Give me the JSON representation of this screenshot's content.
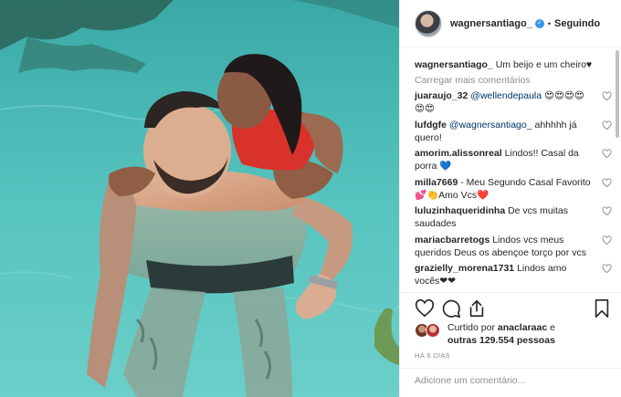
{
  "header": {
    "username": "wagnersantiago_",
    "separator": "•",
    "follow_label": "Seguindo"
  },
  "caption": {
    "username": "wagnersantiago_",
    "text": "Um beijo e um cheiro♥"
  },
  "load_more_label": "Carregar mais comentários",
  "comments": [
    {
      "user": "juaraujo_32",
      "mention": "@wellendepaula",
      "text": " 😍😍😍😍😍😍"
    },
    {
      "user": "lufdgfe",
      "mention": "@wagnersantiago_",
      "text": " ahhhhh já quero!"
    },
    {
      "user": "amorim.alissonreal",
      "mention": "",
      "text": "Lindos!! Casal da porra 💙"
    },
    {
      "user": "milla7669",
      "mention": "",
      "text": "- Meu Segundo Casal Favorito💕👏Amo Vcs❤️"
    },
    {
      "user": "luluzinhaqueridinha",
      "mention": "",
      "text": "De vcs muitas saudades"
    },
    {
      "user": "mariacbarretogs",
      "mention": "",
      "text": "Lindos vcs meus queridos Deus os abençoe torço por vcs"
    },
    {
      "user": "grazielly_morena1731",
      "mention": "",
      "text": "Lindos amo vocês❤❤"
    }
  ],
  "likes": {
    "prefix": "Curtido por ",
    "user": "anaclaraac",
    "middle": " e",
    "others": "outras 129.554 pessoas"
  },
  "time_label": "HÁ 6 DIAS",
  "add_comment_placeholder": "Adicione um comentário...",
  "icons": {
    "like": "heart-icon",
    "comment": "comment-bubble-icon",
    "share": "share-icon",
    "save": "bookmark-icon",
    "verified": "verified-check-icon"
  },
  "colors": {
    "verified": "#3897f0",
    "mention": "#003569",
    "muted": "#8e8e8e",
    "pool": "#4fb9b6"
  }
}
